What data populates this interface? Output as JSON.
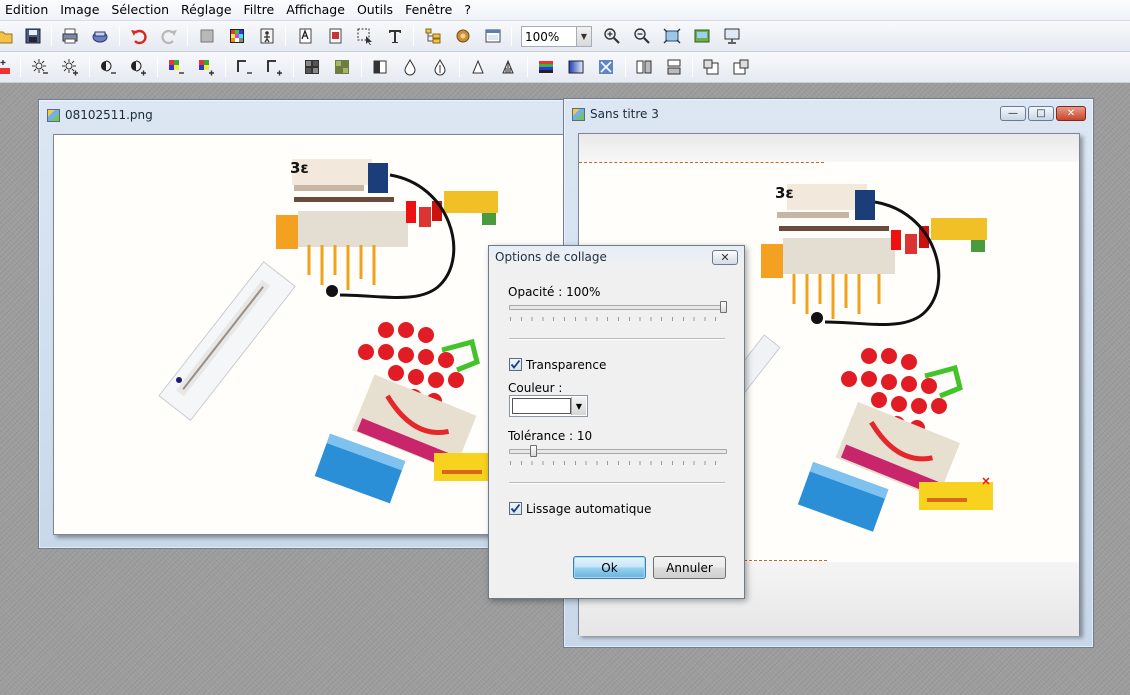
{
  "menu": [
    "Edition",
    "Image",
    "Sélection",
    "Réglage",
    "Filtre",
    "Affichage",
    "Outils",
    "Fenêtre",
    "?"
  ],
  "toolbar": {
    "zoom_value": "100%"
  },
  "window1": {
    "title": "08102511.png"
  },
  "window2": {
    "title": "Sans titre 3"
  },
  "collage_art": {
    "label_3e": "3ε"
  },
  "dialog": {
    "title": "Options de collage",
    "opacity_label": "Opacité : 100%",
    "opacity_value": 100,
    "transparency_label": "Transparence",
    "transparency_checked": true,
    "color_label": "Couleur :",
    "color_value": "#ffffff",
    "tolerance_label": "Tolérance : 10",
    "tolerance_value": 10,
    "smoothing_label": "Lissage automatique",
    "smoothing_checked": true,
    "ok_label": "Ok",
    "cancel_label": "Annuler"
  },
  "colors": {
    "menubar_bg": "#f3f6fb",
    "workspace_bg": "#9c9c9c",
    "window_frame": "#c9d8e9",
    "dialog_bg": "#f0f0f0",
    "ok_button": "#98d1ef"
  }
}
